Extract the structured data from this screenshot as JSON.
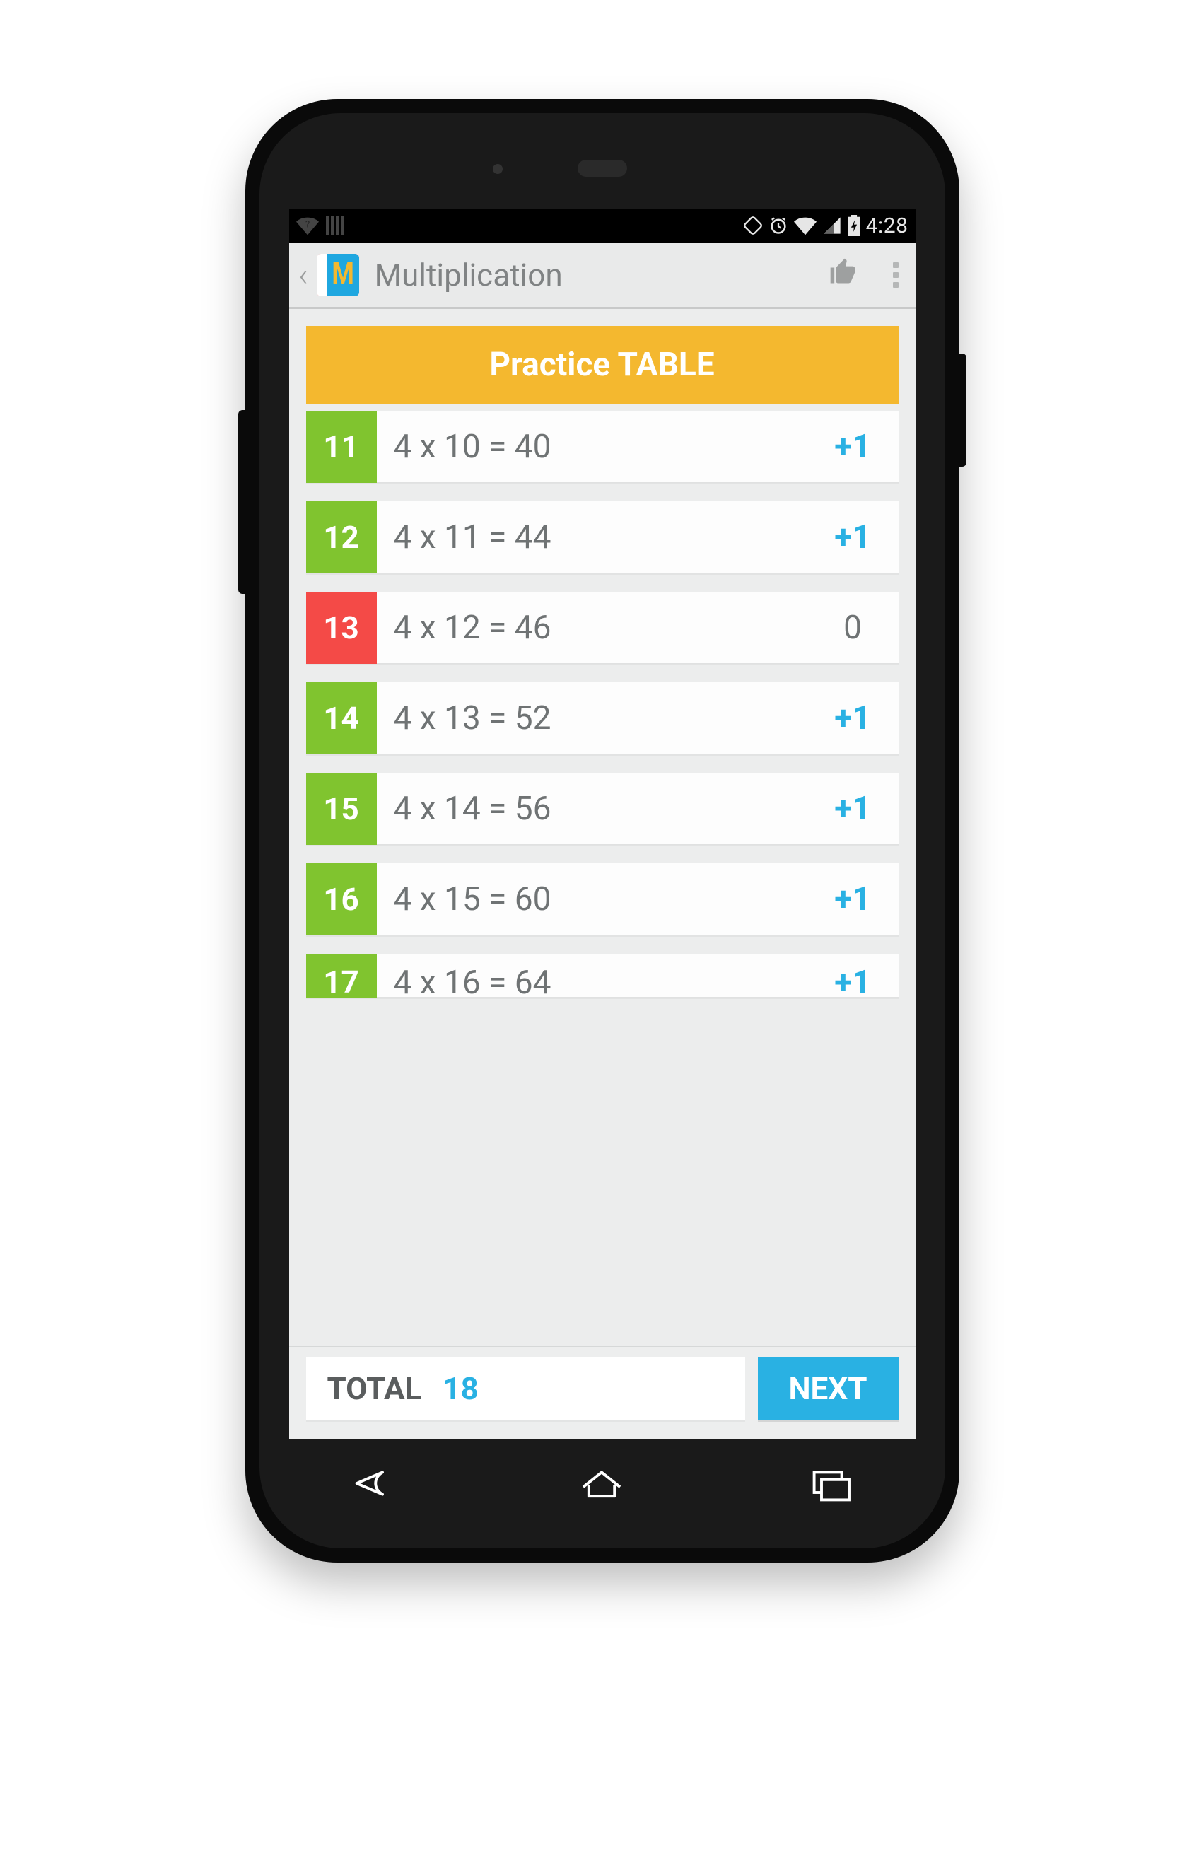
{
  "status": {
    "time": "4:28"
  },
  "actionbar": {
    "title": "Multiplication"
  },
  "header": {
    "title": "Practice TABLE"
  },
  "rows": [
    {
      "n": "11",
      "eq": "4 x 10 = 40",
      "score": "+1",
      "correct": true
    },
    {
      "n": "12",
      "eq": "4 x 11 = 44",
      "score": "+1",
      "correct": true
    },
    {
      "n": "13",
      "eq": "4 x 12 = 46",
      "score": "0",
      "correct": false
    },
    {
      "n": "14",
      "eq": "4 x 13 = 52",
      "score": "+1",
      "correct": true
    },
    {
      "n": "15",
      "eq": "4 x 14 = 56",
      "score": "+1",
      "correct": true
    },
    {
      "n": "16",
      "eq": "4 x 15 = 60",
      "score": "+1",
      "correct": true
    },
    {
      "n": "17",
      "eq": "4 x 16 = 64",
      "score": "+1",
      "correct": true
    }
  ],
  "footer": {
    "total_label": "TOTAL",
    "total_value": "18",
    "next": "NEXT"
  }
}
